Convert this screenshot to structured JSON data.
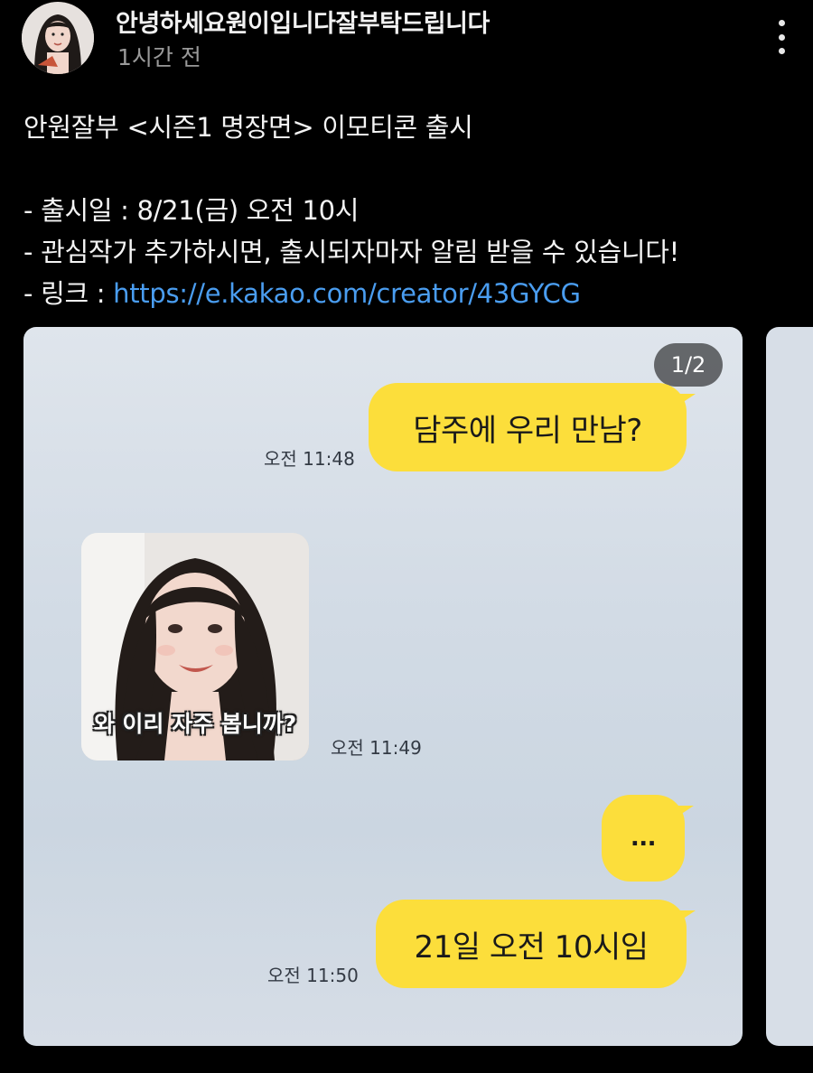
{
  "post": {
    "author": "안녕하세요원이입니다잘부탁드립니다",
    "time": "1시간 전",
    "body": {
      "title": "안원잘부 <시즌1 명장면> 이모티콘 출시",
      "line1": "- 출시일 : 8/21(금) 오전 10시",
      "line2": "- 관심작가 추가하시면, 출시되자마자 알림 받을 수 있습니다!",
      "link_prefix": "- 링크 : ",
      "link_text": "https://e.kakao.com/creator/43GYCG"
    }
  },
  "carousel": {
    "counter": "1/2",
    "messages": [
      {
        "text": "담주에 우리 만남?",
        "time": "오전 11:48"
      },
      {
        "sticker_caption": "와 이리 자주 봅니까?",
        "time": "오전 11:49"
      },
      {
        "text": "..."
      },
      {
        "text": "21일 오전 10시임",
        "time": "오전 11:50"
      }
    ]
  },
  "colors": {
    "background": "#000000",
    "link": "#4a9df0",
    "bubble": "#fcde3b",
    "chat_background": "#d2dbe5"
  },
  "icons": [
    "more-vertical-icon"
  ]
}
